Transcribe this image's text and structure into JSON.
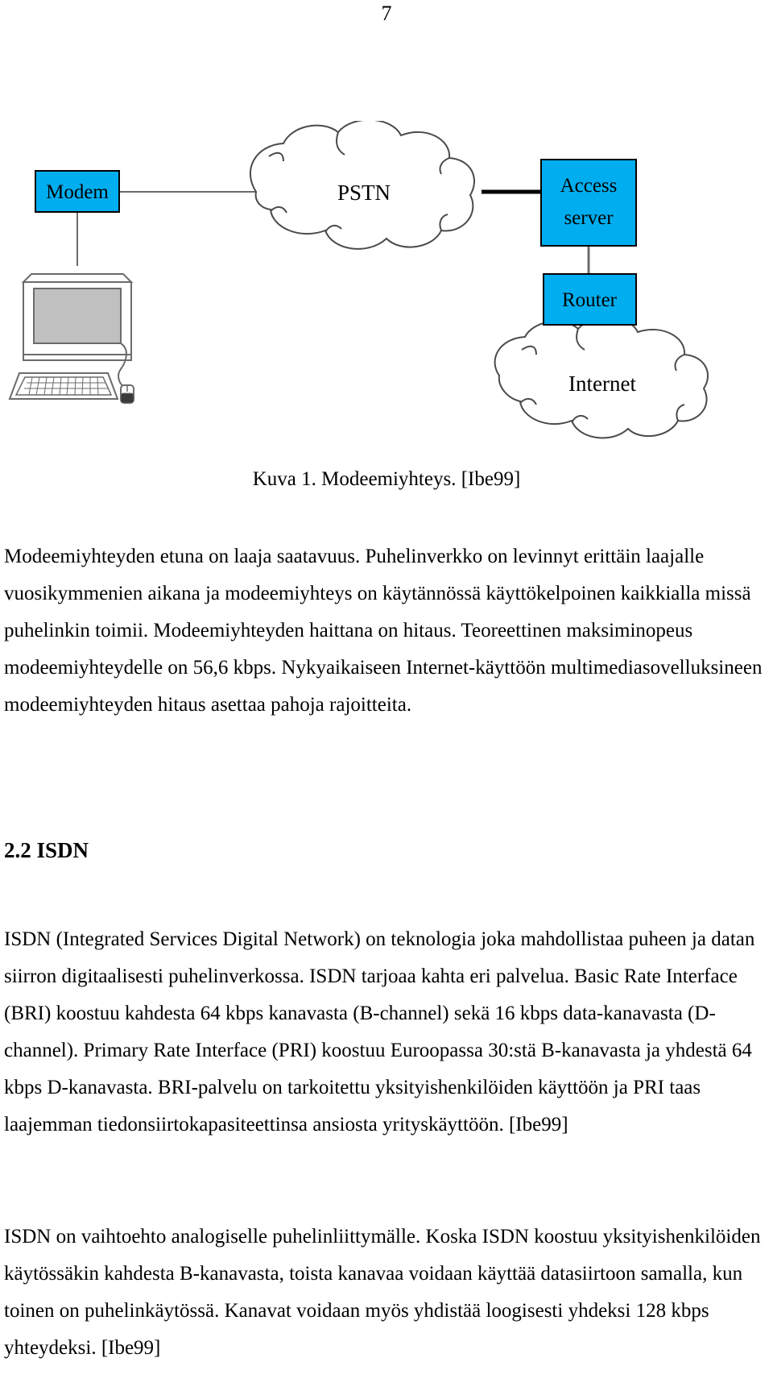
{
  "page": {
    "number": "7"
  },
  "figure": {
    "nodes": {
      "modem": "Modem",
      "access_server_line1": "Access",
      "access_server_line2": "server",
      "router": "Router"
    },
    "clouds": {
      "pstn": "PSTN",
      "internet": "Internet"
    },
    "workstation_icon": "desktop-computer-icon",
    "caption": "Kuva 1. Modeemiyhteys. [Ibe99]",
    "colors": {
      "box_fill": "#00AEEF",
      "box_stroke": "#000000",
      "cloud_stroke": "#4a4a4a",
      "screen_fill": "#c0c0c0",
      "link_line": "#6b6b6b",
      "link_line_bold": "#000000"
    }
  },
  "content": {
    "paragraph_1": "Modeemiyhteyden etuna on laaja saatavuus. Puhelinverkko on levinnyt erittäin laajalle vuosikymmenien aikana ja modeemiyhteys on käytännössä käyttökelpoinen kaikkialla missä puhelinkin toimii. Modeemiyhteyden haittana on hitaus. Teoreettinen maksiminopeus modeemiyhteydelle on 56,6 kbps. Nykyaikaiseen Internet-käyttöön multimediasovelluksineen modeemiyhteyden hitaus asettaa pahoja rajoitteita.",
    "heading_2_2": "2.2 ISDN",
    "paragraph_2": "ISDN (Integrated Services Digital Network) on teknologia joka mahdollistaa puheen ja datan siirron digitaalisesti puhelinverkossa. ISDN tarjoaa kahta eri palvelua. Basic Rate Interface (BRI) koostuu kahdesta 64 kbps kanavasta (B-channel) sekä 16 kbps data-kanavasta (D-channel). Primary Rate Interface (PRI) koostuu Euroopassa 30:stä B-kanavasta ja yhdestä 64 kbps D-kanavasta. BRI-palvelu on tarkoitettu yksityishenkilöiden käyttöön ja PRI taas laajemman tiedonsiirtokapasiteettinsa ansiosta yrityskäyttöön. [Ibe99]",
    "paragraph_3": "ISDN on vaihtoehto analogiselle puhelinliittymälle. Koska ISDN koostuu yksityishenkilöiden käytössäkin kahdesta B-kanavasta, toista kanavaa voidaan käyttää datasiirtoon samalla, kun toinen on puhelinkäytössä. Kanavat voidaan myös yhdistää loogisesti yhdeksi 128 kbps yhteydeksi. [Ibe99]"
  }
}
